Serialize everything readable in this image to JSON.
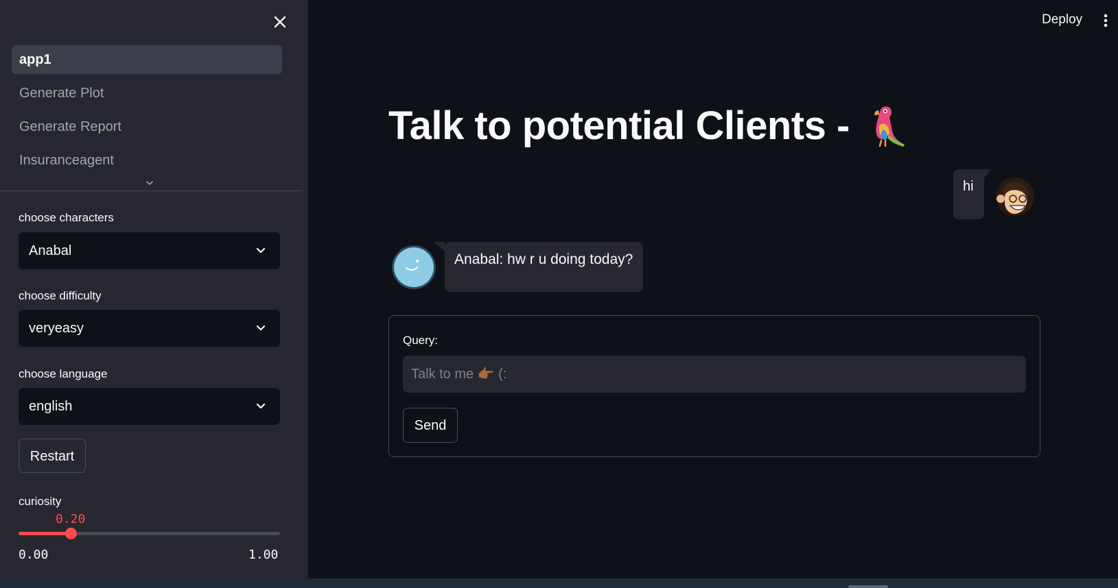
{
  "sidebar": {
    "nav_items": [
      {
        "label": "app1",
        "active": true
      },
      {
        "label": "Generate Plot"
      },
      {
        "label": "Generate Report"
      },
      {
        "label": "Insuranceagent"
      }
    ],
    "characters": {
      "label": "choose characters",
      "value": "Anabal"
    },
    "difficulty": {
      "label": "choose difficulty",
      "value": "veryeasy"
    },
    "language": {
      "label": "choose language",
      "value": "english"
    },
    "restart_label": "Restart",
    "curiosity": {
      "label": "curiosity",
      "value_text": "0.20",
      "value": 0.2,
      "min_text": "0.00",
      "max_text": "1.00"
    }
  },
  "header": {
    "deploy_label": "Deploy"
  },
  "main": {
    "title": "Talk to potential Clients -",
    "messages": [
      {
        "role": "user",
        "text": "hi"
      },
      {
        "role": "assistant",
        "text": "Anabal: hw r u doing today?"
      }
    ],
    "form": {
      "query_label": "Query:",
      "query_placeholder": "Talk to me 👉🏾 (:",
      "query_value": "",
      "send_label": "Send"
    }
  },
  "colors": {
    "accent": "#ff4b4b",
    "background": "#0e1117",
    "sidebar": "#262730"
  }
}
